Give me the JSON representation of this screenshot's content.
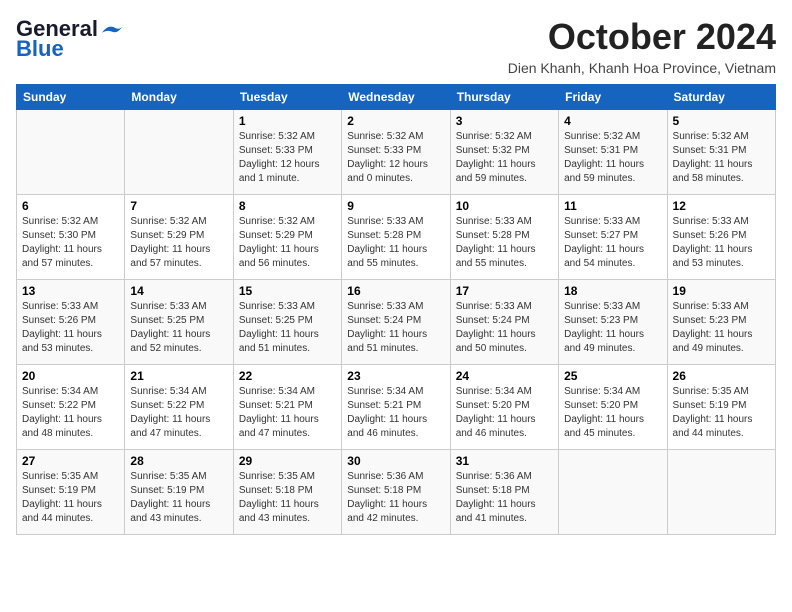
{
  "logo": {
    "general": "General",
    "blue": "Blue"
  },
  "header": {
    "month": "October 2024",
    "subtitle": "Dien Khanh, Khanh Hoa Province, Vietnam"
  },
  "weekdays": [
    "Sunday",
    "Monday",
    "Tuesday",
    "Wednesday",
    "Thursday",
    "Friday",
    "Saturday"
  ],
  "weeks": [
    [
      {
        "day": "",
        "info": ""
      },
      {
        "day": "",
        "info": ""
      },
      {
        "day": "1",
        "info": "Sunrise: 5:32 AM\nSunset: 5:33 PM\nDaylight: 12 hours\nand 1 minute."
      },
      {
        "day": "2",
        "info": "Sunrise: 5:32 AM\nSunset: 5:33 PM\nDaylight: 12 hours\nand 0 minutes."
      },
      {
        "day": "3",
        "info": "Sunrise: 5:32 AM\nSunset: 5:32 PM\nDaylight: 11 hours\nand 59 minutes."
      },
      {
        "day": "4",
        "info": "Sunrise: 5:32 AM\nSunset: 5:31 PM\nDaylight: 11 hours\nand 59 minutes."
      },
      {
        "day": "5",
        "info": "Sunrise: 5:32 AM\nSunset: 5:31 PM\nDaylight: 11 hours\nand 58 minutes."
      }
    ],
    [
      {
        "day": "6",
        "info": "Sunrise: 5:32 AM\nSunset: 5:30 PM\nDaylight: 11 hours\nand 57 minutes."
      },
      {
        "day": "7",
        "info": "Sunrise: 5:32 AM\nSunset: 5:29 PM\nDaylight: 11 hours\nand 57 minutes."
      },
      {
        "day": "8",
        "info": "Sunrise: 5:32 AM\nSunset: 5:29 PM\nDaylight: 11 hours\nand 56 minutes."
      },
      {
        "day": "9",
        "info": "Sunrise: 5:33 AM\nSunset: 5:28 PM\nDaylight: 11 hours\nand 55 minutes."
      },
      {
        "day": "10",
        "info": "Sunrise: 5:33 AM\nSunset: 5:28 PM\nDaylight: 11 hours\nand 55 minutes."
      },
      {
        "day": "11",
        "info": "Sunrise: 5:33 AM\nSunset: 5:27 PM\nDaylight: 11 hours\nand 54 minutes."
      },
      {
        "day": "12",
        "info": "Sunrise: 5:33 AM\nSunset: 5:26 PM\nDaylight: 11 hours\nand 53 minutes."
      }
    ],
    [
      {
        "day": "13",
        "info": "Sunrise: 5:33 AM\nSunset: 5:26 PM\nDaylight: 11 hours\nand 53 minutes."
      },
      {
        "day": "14",
        "info": "Sunrise: 5:33 AM\nSunset: 5:25 PM\nDaylight: 11 hours\nand 52 minutes."
      },
      {
        "day": "15",
        "info": "Sunrise: 5:33 AM\nSunset: 5:25 PM\nDaylight: 11 hours\nand 51 minutes."
      },
      {
        "day": "16",
        "info": "Sunrise: 5:33 AM\nSunset: 5:24 PM\nDaylight: 11 hours\nand 51 minutes."
      },
      {
        "day": "17",
        "info": "Sunrise: 5:33 AM\nSunset: 5:24 PM\nDaylight: 11 hours\nand 50 minutes."
      },
      {
        "day": "18",
        "info": "Sunrise: 5:33 AM\nSunset: 5:23 PM\nDaylight: 11 hours\nand 49 minutes."
      },
      {
        "day": "19",
        "info": "Sunrise: 5:33 AM\nSunset: 5:23 PM\nDaylight: 11 hours\nand 49 minutes."
      }
    ],
    [
      {
        "day": "20",
        "info": "Sunrise: 5:34 AM\nSunset: 5:22 PM\nDaylight: 11 hours\nand 48 minutes."
      },
      {
        "day": "21",
        "info": "Sunrise: 5:34 AM\nSunset: 5:22 PM\nDaylight: 11 hours\nand 47 minutes."
      },
      {
        "day": "22",
        "info": "Sunrise: 5:34 AM\nSunset: 5:21 PM\nDaylight: 11 hours\nand 47 minutes."
      },
      {
        "day": "23",
        "info": "Sunrise: 5:34 AM\nSunset: 5:21 PM\nDaylight: 11 hours\nand 46 minutes."
      },
      {
        "day": "24",
        "info": "Sunrise: 5:34 AM\nSunset: 5:20 PM\nDaylight: 11 hours\nand 46 minutes."
      },
      {
        "day": "25",
        "info": "Sunrise: 5:34 AM\nSunset: 5:20 PM\nDaylight: 11 hours\nand 45 minutes."
      },
      {
        "day": "26",
        "info": "Sunrise: 5:35 AM\nSunset: 5:19 PM\nDaylight: 11 hours\nand 44 minutes."
      }
    ],
    [
      {
        "day": "27",
        "info": "Sunrise: 5:35 AM\nSunset: 5:19 PM\nDaylight: 11 hours\nand 44 minutes."
      },
      {
        "day": "28",
        "info": "Sunrise: 5:35 AM\nSunset: 5:19 PM\nDaylight: 11 hours\nand 43 minutes."
      },
      {
        "day": "29",
        "info": "Sunrise: 5:35 AM\nSunset: 5:18 PM\nDaylight: 11 hours\nand 43 minutes."
      },
      {
        "day": "30",
        "info": "Sunrise: 5:36 AM\nSunset: 5:18 PM\nDaylight: 11 hours\nand 42 minutes."
      },
      {
        "day": "31",
        "info": "Sunrise: 5:36 AM\nSunset: 5:18 PM\nDaylight: 11 hours\nand 41 minutes."
      },
      {
        "day": "",
        "info": ""
      },
      {
        "day": "",
        "info": ""
      }
    ]
  ]
}
